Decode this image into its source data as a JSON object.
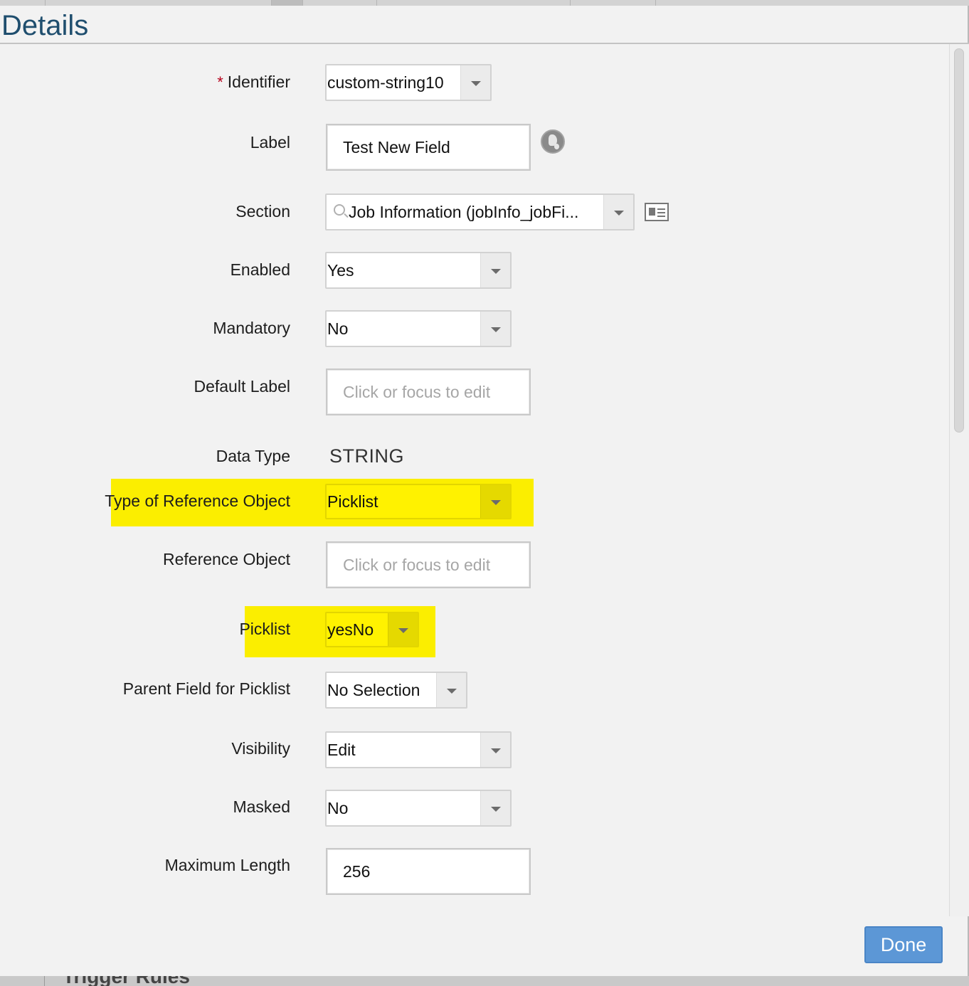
{
  "dialog": {
    "title": "Details",
    "done_label": "Done"
  },
  "background": {
    "partial_text": "Trigger Rules"
  },
  "fields": {
    "identifier": {
      "label": "Identifier",
      "required_marker": "*",
      "value": "custom-string10"
    },
    "label": {
      "label": "Label",
      "value": "Test New Field",
      "icon": "globe-icon"
    },
    "section": {
      "label": "Section",
      "value": "Job Information (jobInfo_jobFi...",
      "icon": "details-card-icon"
    },
    "enabled": {
      "label": "Enabled",
      "value": "Yes"
    },
    "mandatory": {
      "label": "Mandatory",
      "value": "No"
    },
    "default_label": {
      "label": "Default Label",
      "placeholder": "Click or focus to edit"
    },
    "data_type": {
      "label": "Data Type",
      "value": "STRING"
    },
    "type_of_reference_object": {
      "label": "Type of Reference Object",
      "value": "Picklist",
      "highlight_color": "#fbee00"
    },
    "reference_object": {
      "label": "Reference Object",
      "placeholder": "Click or focus to edit"
    },
    "picklist": {
      "label": "Picklist",
      "value": "yesNo",
      "highlight_color": "#fbee00"
    },
    "parent_field_for_picklist": {
      "label": "Parent Field for Picklist",
      "value": "No Selection"
    },
    "visibility": {
      "label": "Visibility",
      "value": "Edit"
    },
    "masked": {
      "label": "Masked",
      "value": "No"
    },
    "maximum_length": {
      "label": "Maximum Length",
      "value": "256"
    }
  },
  "colors": {
    "title": "#1f4e6e",
    "done_button": "#5c97d6",
    "required": "#b5001b",
    "highlight": "#fbee00"
  }
}
